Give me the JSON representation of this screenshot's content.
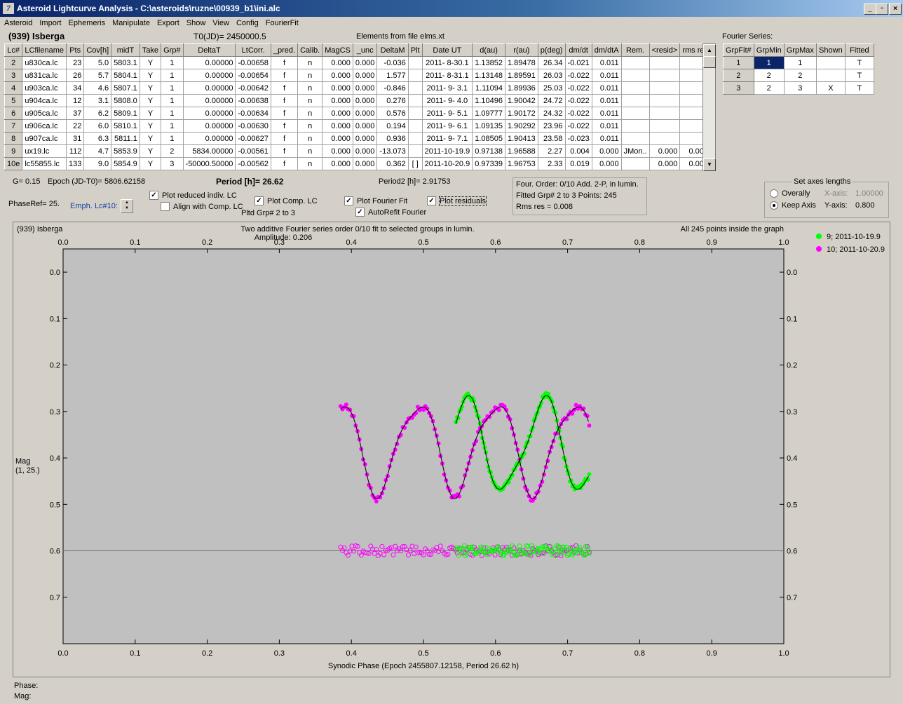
{
  "window": {
    "title": "Asteroid Lightcurve Analysis - C:\\asteroids\\ruzne\\00939_b1\\ini.alc",
    "icon": "app-icon",
    "minimize": "_",
    "maximize": "▫",
    "close": "×"
  },
  "menu": [
    "Asteroid",
    "Import",
    "Ephemeris",
    "Manipulate",
    "Export",
    "Show",
    "View",
    "Config",
    "FourierFit"
  ],
  "header": {
    "asteroid": "(939) Isberga",
    "t0": "T0(JD)= 2450000.5",
    "elements": "Elements from file elms.xt",
    "fourier_series_label": "Fourier Series:"
  },
  "lc_table": {
    "columns": [
      "Lc#",
      "LCfilename",
      "Pts",
      "Cov[h]",
      "midT",
      "Take",
      "Grp#",
      "DeltaT",
      "LtCorr.",
      "_pred.",
      "Calib.",
      "MagCS",
      "_unc",
      "DeltaM",
      "Plt",
      "Date UT",
      "d(au)",
      "r(au)",
      "p(deg)",
      "dm/dt",
      "dm/dtA",
      "Rem.",
      "<resid>",
      "rms res"
    ],
    "rows": [
      [
        "2",
        "u830ca.lc",
        "23",
        "5.0",
        "5803.1",
        "Y",
        "1",
        "0.00000",
        "-0.00658",
        "f",
        "n",
        "0.000",
        "0.000",
        "-0.036",
        "",
        "2011- 8-30.1",
        "1.13852",
        "1.89478",
        "26.34",
        "-0.021",
        "0.011",
        "",
        "",
        ""
      ],
      [
        "3",
        "u831ca.lc",
        "26",
        "5.7",
        "5804.1",
        "Y",
        "1",
        "0.00000",
        "-0.00654",
        "f",
        "n",
        "0.000",
        "0.000",
        "1.577",
        "",
        "2011- 8-31.1",
        "1.13148",
        "1.89591",
        "26.03",
        "-0.022",
        "0.011",
        "",
        "",
        ""
      ],
      [
        "4",
        "u903ca.lc",
        "34",
        "4.6",
        "5807.1",
        "Y",
        "1",
        "0.00000",
        "-0.00642",
        "f",
        "n",
        "0.000",
        "0.000",
        "-0.846",
        "",
        "2011- 9- 3.1",
        "1.11094",
        "1.89936",
        "25.03",
        "-0.022",
        "0.011",
        "",
        "",
        ""
      ],
      [
        "5",
        "u904ca.lc",
        "12",
        "3.1",
        "5808.0",
        "Y",
        "1",
        "0.00000",
        "-0.00638",
        "f",
        "n",
        "0.000",
        "0.000",
        "0.276",
        "",
        "2011- 9- 4.0",
        "1.10496",
        "1.90042",
        "24.72",
        "-0.022",
        "0.011",
        "",
        "",
        ""
      ],
      [
        "6",
        "u905ca.lc",
        "37",
        "6.2",
        "5809.1",
        "Y",
        "1",
        "0.00000",
        "-0.00634",
        "f",
        "n",
        "0.000",
        "0.000",
        "0.576",
        "",
        "2011- 9- 5.1",
        "1.09777",
        "1.90172",
        "24.32",
        "-0.022",
        "0.011",
        "",
        "",
        ""
      ],
      [
        "7",
        "u906ca.lc",
        "22",
        "6.0",
        "5810.1",
        "Y",
        "1",
        "0.00000",
        "-0.00630",
        "f",
        "n",
        "0.000",
        "0.000",
        "0.194",
        "",
        "2011- 9- 6.1",
        "1.09135",
        "1.90292",
        "23.96",
        "-0.022",
        "0.011",
        "",
        "",
        ""
      ],
      [
        "8",
        "u907ca.lc",
        "31",
        "6.3",
        "5811.1",
        "Y",
        "1",
        "0.00000",
        "-0.00627",
        "f",
        "n",
        "0.000",
        "0.000",
        "0.936",
        "",
        "2011- 9- 7.1",
        "1.08505",
        "1.90413",
        "23.58",
        "-0.023",
        "0.011",
        "",
        "",
        ""
      ],
      [
        "9",
        "ux19.lc",
        "112",
        "4.7",
        "5853.9",
        "Y",
        "2",
        "5834.00000",
        "-0.00561",
        "f",
        "n",
        "0.000",
        "0.000",
        "-13.073",
        "",
        "2011-10-19.9",
        "0.97138",
        "1.96588",
        "2.27",
        "0.004",
        "0.000",
        "JMon..",
        "0.000",
        "0.007"
      ],
      [
        "10e",
        "lc55855.lc",
        "133",
        "9.0",
        "5854.9",
        "Y",
        "3",
        "-50000.50000",
        "-0.00562",
        "f",
        "n",
        "0.000",
        "0.000",
        "0.362",
        "[ ]",
        "2011-10-20.9",
        "0.97339",
        "1.96753",
        "2.33",
        "0.019",
        "0.000",
        "",
        "0.000",
        "0.008"
      ]
    ]
  },
  "fourier_table": {
    "columns": [
      "GrpFit#",
      "GrpMin",
      "GrpMax",
      "Shown",
      "Fitted"
    ],
    "rows": [
      [
        "1",
        "1",
        "1",
        "",
        "T"
      ],
      [
        "2",
        "2",
        "2",
        "",
        "T"
      ],
      [
        "3",
        "2",
        "3",
        "X",
        "T"
      ]
    ]
  },
  "controls": {
    "g": "G= 0.15",
    "epoch": "Epoch (JD-T0)= 5806.62158",
    "period": "Period [h]= 26.62",
    "period2": "Period2 [h]= 2.91753",
    "phaseref": "PhaseRef= 25.",
    "emph": "Emph. Lc#10:",
    "plot_reduced": "Plot reduced indiv. LC",
    "align_comp": "Align with Comp. LC",
    "plot_comp": "Plot Comp. LC",
    "pltd_grp": "Pltd Grp#  2  to   3",
    "plot_fourier": "Plot Fourier Fit",
    "autorefit": "AutoRefit Fourier",
    "plot_residuals": "Plot residuals",
    "four_order": "Four. Order:  0/10    Add. 2-P, in lumin.",
    "fitted_grp": "Fitted Grp# 2 to 3     Points: 245",
    "rms_res": "Rms res     = 0.008",
    "axes_title": "Set axes lengths",
    "overally": "Overally",
    "keep_axis": "Keep Axis",
    "x_axis_label": "X-axis:",
    "x_axis_val": "1.00000",
    "y_axis_label": "Y-axis:",
    "y_axis_val": "0.800"
  },
  "checks": {
    "plot_reduced": true,
    "align_comp": false,
    "plot_comp": true,
    "plot_fourier": true,
    "autorefit": true,
    "plot_residuals": true
  },
  "plot": {
    "corner_label": "(939) Isberga",
    "subtitle1": "Two additive Fourier series order 0/10 fit to selected groups in lumin.",
    "subtitle2": "Amplitude: 0.206",
    "inside": "All 245 points inside the graph",
    "ylabel": "Mag\n(1, 25.)",
    "xlabel": "Synodic Phase (Epoch 2455807.12158, Period 26.62 h)",
    "phase_label": "Phase:",
    "mag_label": "Mag:"
  },
  "chart_data": {
    "type": "scatter",
    "xlim": [
      0,
      1
    ],
    "ylim": [
      0.8,
      -0.05
    ],
    "xticks": [
      "0.0",
      "0.1",
      "0.2",
      "0.3",
      "0.4",
      "0.5",
      "0.6",
      "0.7",
      "0.8",
      "0.9",
      "1.0"
    ],
    "yticks": [
      "0.0",
      "0.1",
      "0.2",
      "0.3",
      "0.4",
      "0.5",
      "0.6",
      "0.7"
    ],
    "residual_baseline": 0.6,
    "fit": {
      "x_start": 0.385,
      "x_end": 0.73
    },
    "series": [
      {
        "name": "9; 2011-10-19.9",
        "color": "#00ff00",
        "x_range": [
          0.545,
          0.73
        ],
        "count": 112
      },
      {
        "name": "10; 2011-10-20.9",
        "color": "#ff00ff",
        "x_range": [
          0.385,
          0.73
        ],
        "count": 133
      }
    ]
  }
}
